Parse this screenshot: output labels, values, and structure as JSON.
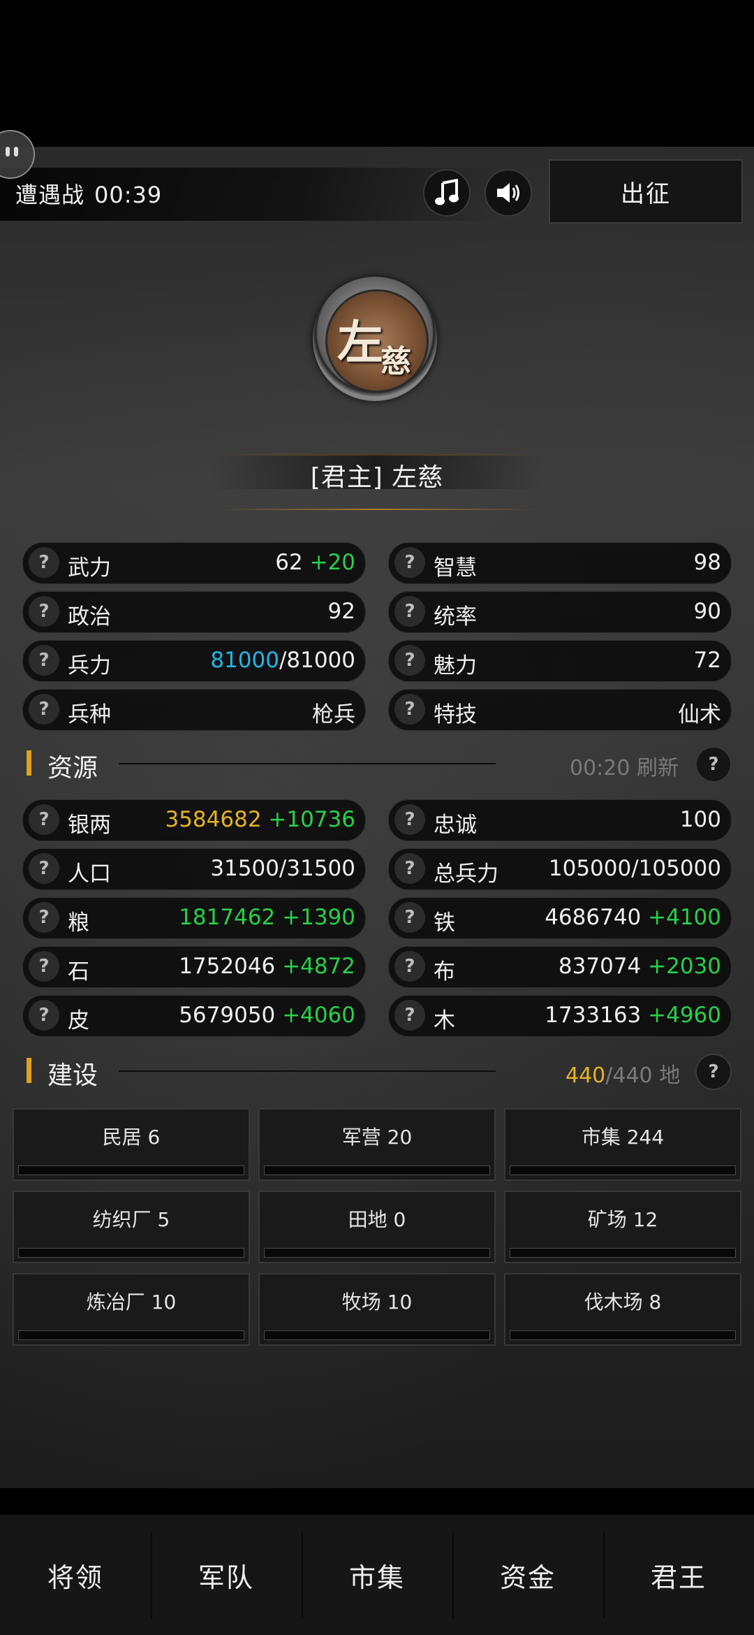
{
  "topbar": {
    "battle_label": "遭遇战",
    "battle_timer": "00:39",
    "music_icon": "music-note-icon",
    "sound_icon": "speaker-icon",
    "march_label": "出征"
  },
  "lord": {
    "emblem_char_1": "左",
    "emblem_char_2": "慈",
    "title": "[君主] 左慈"
  },
  "stats": [
    {
      "label": "武力",
      "value": "62",
      "bonus": "+20"
    },
    {
      "label": "智慧",
      "value": "98"
    },
    {
      "label": "政治",
      "value": "92"
    },
    {
      "label": "统率",
      "value": "90"
    },
    {
      "label": "兵力",
      "current": "81000",
      "max": "/81000"
    },
    {
      "label": "魅力",
      "value": "72"
    },
    {
      "label": "兵种",
      "value": "枪兵"
    },
    {
      "label": "特技",
      "value": "仙术"
    }
  ],
  "resources_section": {
    "title": "资源",
    "refresh_time": "00:20",
    "refresh_label": "刷新"
  },
  "resources": [
    {
      "label": "银两",
      "value": "3584682",
      "bonus": "+10736"
    },
    {
      "label": "忠诚",
      "value": "100"
    },
    {
      "label": "人口",
      "value": "31500/31500"
    },
    {
      "label": "总兵力",
      "value": "105000/105000"
    },
    {
      "label": "粮",
      "value": "1817462",
      "bonus": "+1390"
    },
    {
      "label": "铁",
      "value": "4686740",
      "bonus": "+4100"
    },
    {
      "label": "石",
      "value": "1752046",
      "bonus": "+4872"
    },
    {
      "label": "布",
      "value": "837074",
      "bonus": "+2030"
    },
    {
      "label": "皮",
      "value": "5679050",
      "bonus": "+4060"
    },
    {
      "label": "木",
      "value": "1733163",
      "bonus": "+4960"
    }
  ],
  "build_section": {
    "title": "建设",
    "land_used": "440",
    "land_total": "/440",
    "land_label": "地"
  },
  "buildings": [
    {
      "name": "民居 6"
    },
    {
      "name": "军营 20"
    },
    {
      "name": "市集 244"
    },
    {
      "name": "纺织厂 5"
    },
    {
      "name": "田地 0"
    },
    {
      "name": "矿场 12"
    },
    {
      "name": "炼冶厂 10"
    },
    {
      "name": "牧场 10"
    },
    {
      "name": "伐木场 8"
    }
  ],
  "nav": [
    "将领",
    "军队",
    "市集",
    "资金",
    "君王"
  ],
  "help_mark": "?",
  "colors": {
    "bonus_green": "#28d04a",
    "troop_cyan": "#22b6e6",
    "silver_gold": "#e6b224",
    "section_accent": "#e0a020"
  }
}
